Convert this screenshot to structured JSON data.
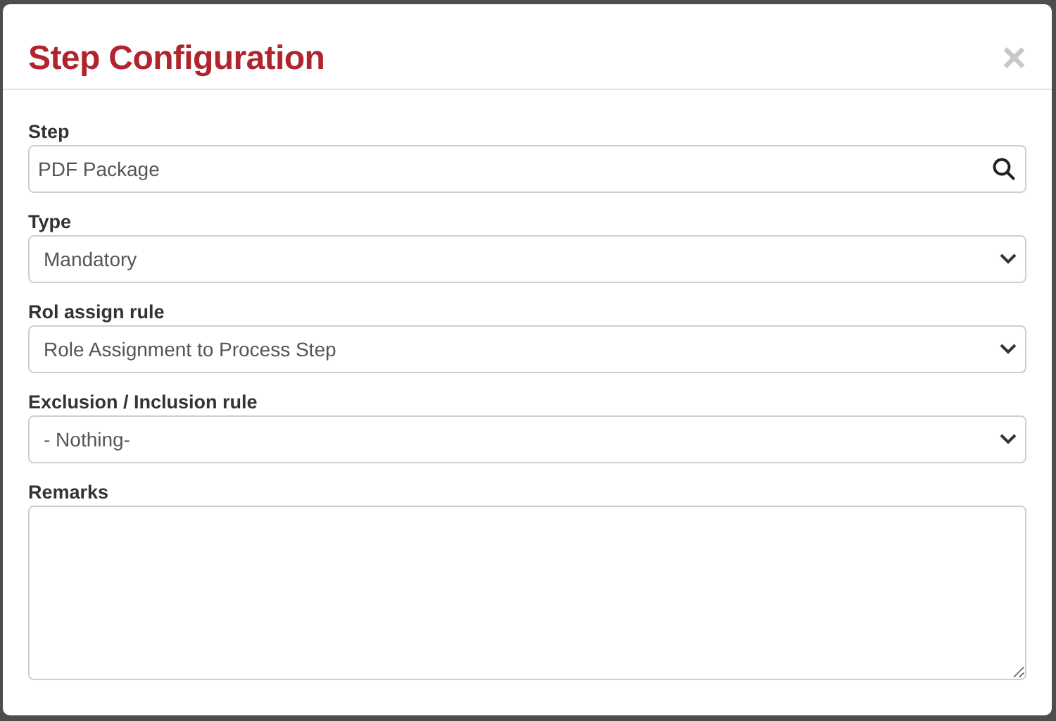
{
  "dialog": {
    "title": "Step Configuration",
    "close": "×"
  },
  "fields": [
    {
      "kind": "search",
      "label": "Step",
      "value": "PDF Package"
    },
    {
      "kind": "select",
      "label": "Type",
      "value": "Mandatory"
    },
    {
      "kind": "select",
      "label": "Rol assign rule",
      "value": "Role Assignment to Process Step"
    },
    {
      "kind": "select",
      "label": "Exclusion / Inclusion rule",
      "value": "- Nothing-"
    },
    {
      "kind": "textarea",
      "label": "Remarks"
    }
  ]
}
